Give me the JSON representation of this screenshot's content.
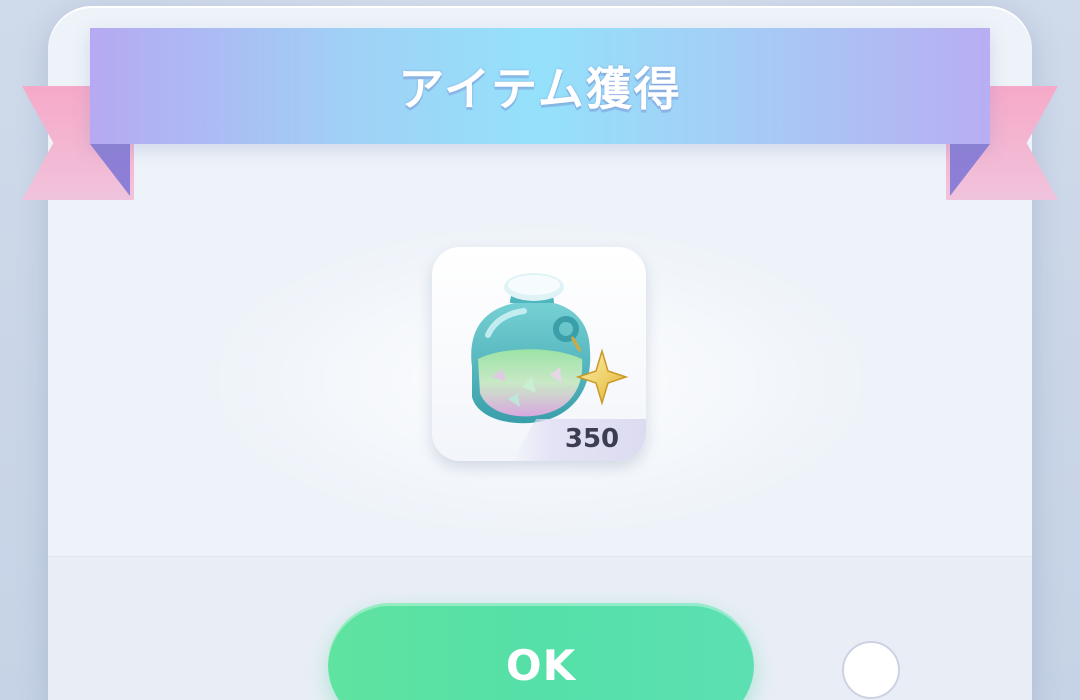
{
  "dialog": {
    "title": "アイテム獲得"
  },
  "reward": {
    "item_icon": "glass-bottle-with-star-charm-icon",
    "quantity": "350"
  },
  "actions": {
    "ok_label": "OK"
  },
  "colors": {
    "ribbon_center": "#95e1fb",
    "ribbon_edges": "#b6a9f2",
    "ribbon_tails": "#f6a9c9",
    "ok_button": "#55e0a8",
    "panel": "#eef3f9"
  }
}
